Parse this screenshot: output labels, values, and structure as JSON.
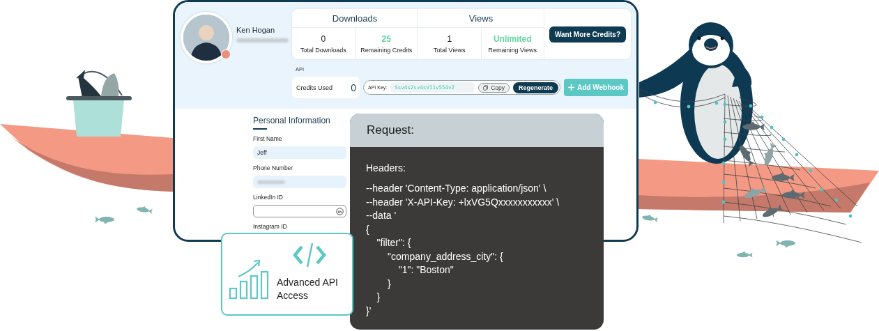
{
  "profile": {
    "name": "Ken Hogan",
    "email_redacted": true
  },
  "stats": [
    {
      "title": "Downloads",
      "items": [
        {
          "value": "0",
          "label": "Total Downloads",
          "highlight": false
        },
        {
          "value": "25",
          "label": "Remaining Credits",
          "highlight": true
        }
      ]
    },
    {
      "title": "Views",
      "items": [
        {
          "value": "1",
          "label": "Total Views",
          "highlight": false
        },
        {
          "value": "Unlimited",
          "label": "Remaining Views",
          "highlight": true
        }
      ]
    }
  ],
  "credits_button": "Want More Credits?",
  "api": {
    "section_label": "API",
    "credits_used_label": "Credits Used",
    "credits_used_value": "0",
    "key_label": "API Key:",
    "key_value": "Ssv4s2sv4sV11v554v2",
    "copy_button": "Copy",
    "regenerate_button": "Regenerate",
    "webhook_button": "Add Webhook"
  },
  "personal_info": {
    "title": "Personal Information",
    "fields": [
      {
        "label": "First Name",
        "kind": "filled",
        "value": "Jeff"
      },
      {
        "label": "Phone Number",
        "kind": "redacted"
      },
      {
        "label": "LinkedIn ID",
        "kind": "linkedin"
      },
      {
        "label": "Instagram ID",
        "kind": "label_only"
      }
    ]
  },
  "request_panel": {
    "title": "Request:",
    "heading": "Headers:",
    "code_lines": [
      "--header 'Content-Type: application/json' \\",
      "--header 'X-API-Key: +lxVG5Qxxxxxxxxxxx' \\",
      "--data '",
      "{",
      "    \"filter\": {",
      "        \"company_address_city\": {",
      "            \"1\": \"Boston\"",
      "        }",
      "    }",
      "}'"
    ]
  },
  "feature_card": {
    "label": "Advanced API Access"
  }
}
